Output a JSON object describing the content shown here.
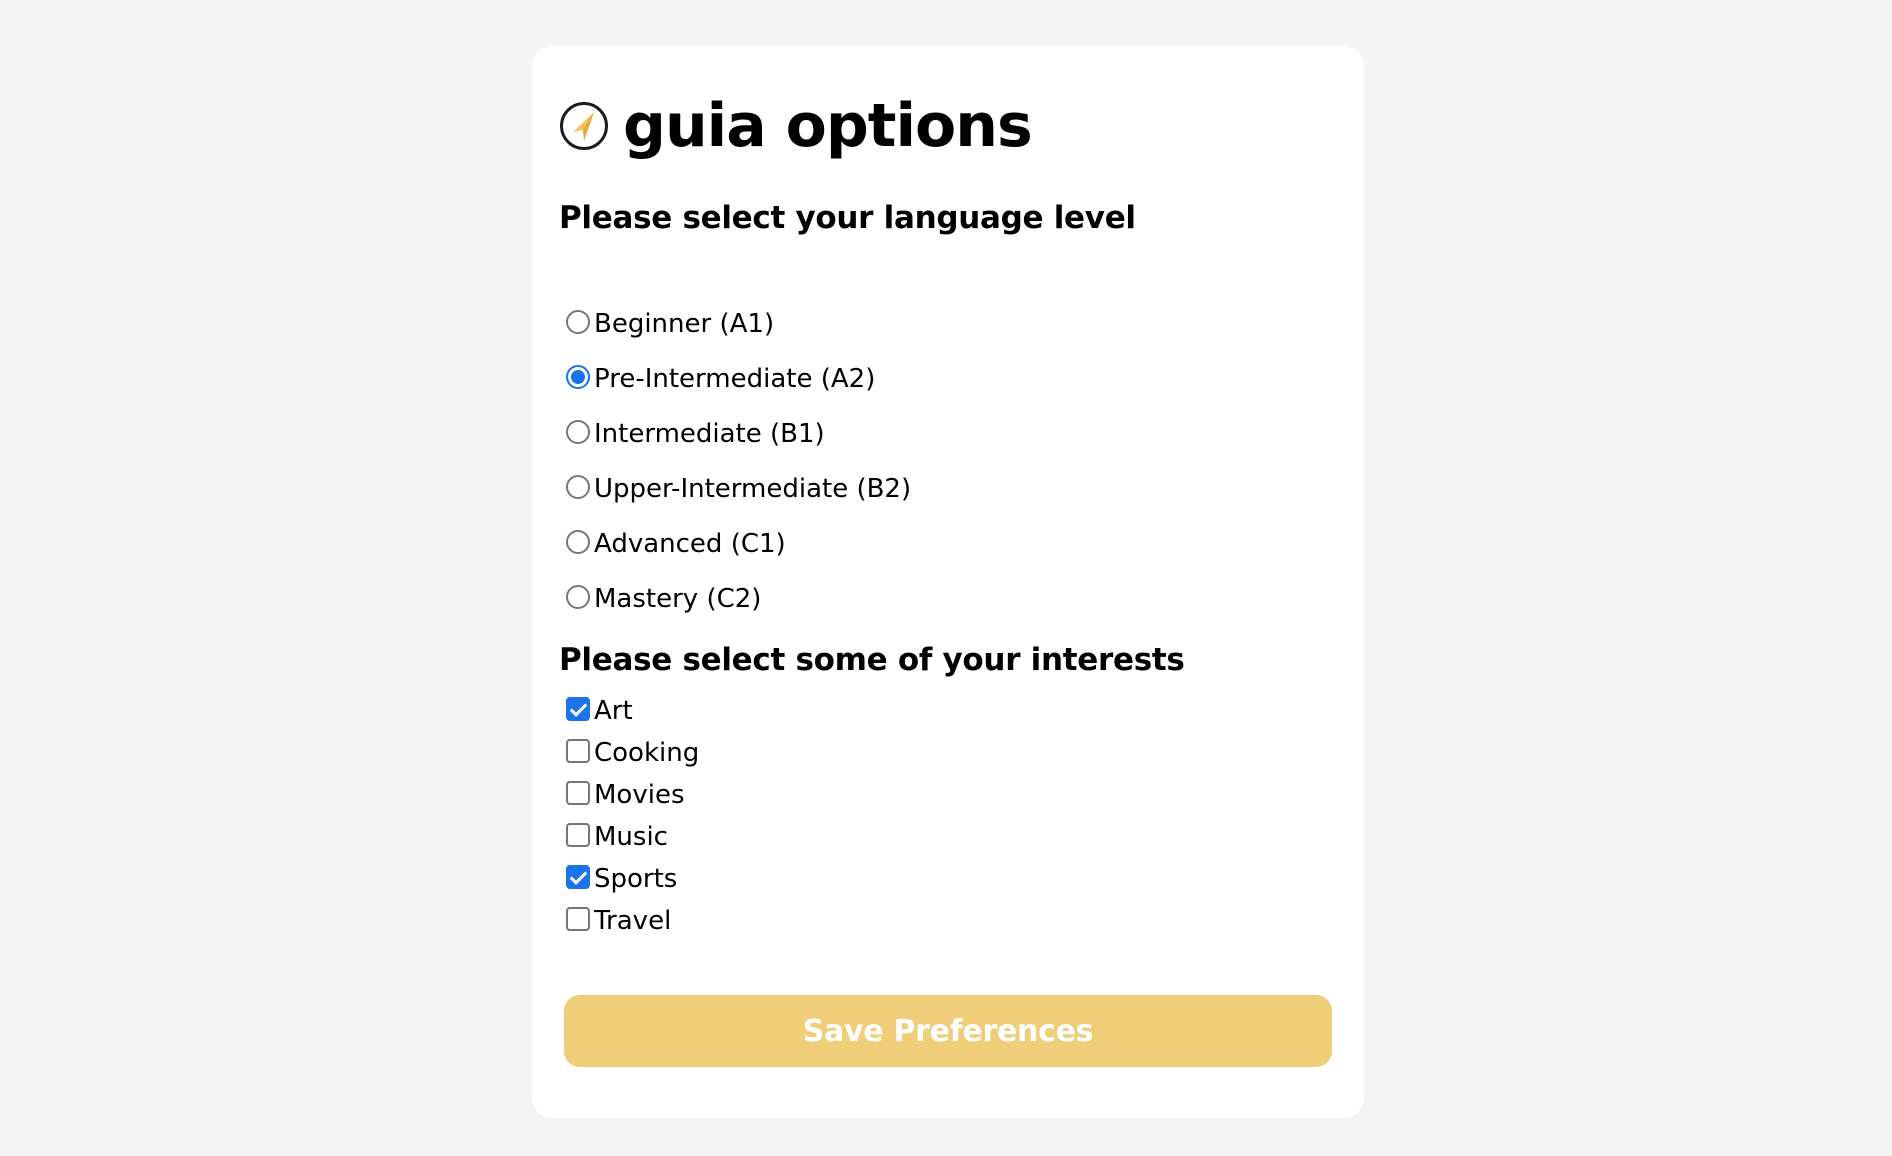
{
  "app": {
    "title": "guia options",
    "logo_icon": "compass-arrow-icon",
    "accent_color": "#f0cd78",
    "selected_color": "#1a73e8"
  },
  "language_section": {
    "heading": "Please select your language level",
    "options": [
      {
        "label": "Beginner (A1)",
        "selected": false
      },
      {
        "label": "Pre-Intermediate (A2)",
        "selected": true
      },
      {
        "label": "Intermediate (B1)",
        "selected": false
      },
      {
        "label": "Upper-Intermediate (B2)",
        "selected": false
      },
      {
        "label": "Advanced (C1)",
        "selected": false
      },
      {
        "label": "Mastery (C2)",
        "selected": false
      }
    ]
  },
  "interests_section": {
    "heading": "Please select some of your interests",
    "options": [
      {
        "label": "Art",
        "checked": true
      },
      {
        "label": "Cooking",
        "checked": false
      },
      {
        "label": "Movies",
        "checked": false
      },
      {
        "label": "Music",
        "checked": false
      },
      {
        "label": "Sports",
        "checked": true
      },
      {
        "label": "Travel",
        "checked": false
      }
    ]
  },
  "actions": {
    "save_label": "Save Preferences"
  }
}
